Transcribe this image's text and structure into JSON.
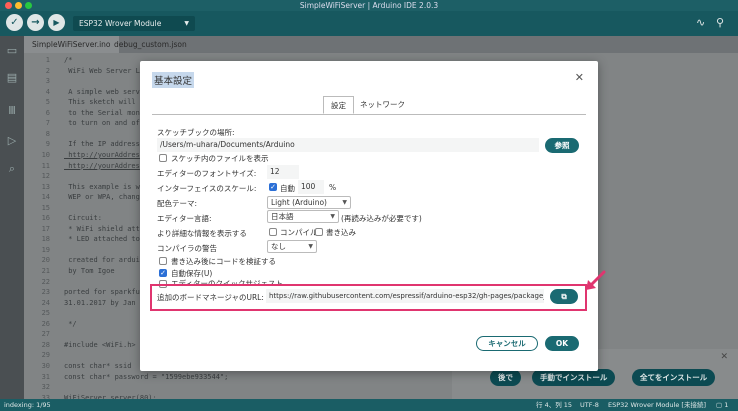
{
  "window": {
    "title": "SimpleWiFiServer | Arduino IDE 2.0.3"
  },
  "toolbar": {
    "board": "ESP32 Wrover Module"
  },
  "tabs": [
    {
      "label": "SimpleWiFiServer.ino"
    },
    {
      "label": "debug_custom.json"
    }
  ],
  "editor": {
    "lines": [
      {
        "num": "1",
        "text": "/*"
      },
      {
        "num": "2",
        "text": " WiFi Web Server L"
      },
      {
        "num": "3",
        "text": ""
      },
      {
        "num": "4",
        "text": " A simple web serv"
      },
      {
        "num": "5",
        "text": " This sketch will"
      },
      {
        "num": "6",
        "text": " to the Serial mon"
      },
      {
        "num": "7",
        "text": " to turn on and of"
      },
      {
        "num": "8",
        "text": ""
      },
      {
        "num": "9",
        "text": " If the IP address"
      },
      {
        "num": "10",
        "text": " http://yourAddres"
      },
      {
        "num": "11",
        "text": " http://yourAddres"
      },
      {
        "num": "12",
        "text": ""
      },
      {
        "num": "13",
        "text": " This example is w"
      },
      {
        "num": "14",
        "text": " WEP or WPA, chang"
      },
      {
        "num": "15",
        "text": ""
      },
      {
        "num": "16",
        "text": " Circuit:"
      },
      {
        "num": "17",
        "text": " * WiFi shield att"
      },
      {
        "num": "18",
        "text": " * LED attached to"
      },
      {
        "num": "19",
        "text": ""
      },
      {
        "num": "20",
        "text": " created for ardui"
      },
      {
        "num": "21",
        "text": " by Tom Igoe"
      },
      {
        "num": "22",
        "text": ""
      },
      {
        "num": "23",
        "text": "ported for sparkfu"
      },
      {
        "num": "24",
        "text": "31.01.2017 by Jan"
      },
      {
        "num": "25",
        "text": ""
      },
      {
        "num": "26",
        "text": " */"
      },
      {
        "num": "27",
        "text": ""
      },
      {
        "num": "28",
        "text": "#include <WiFi.h>"
      },
      {
        "num": "29",
        "text": ""
      },
      {
        "num": "30",
        "text": "const char* ssid"
      },
      {
        "num": "31",
        "text": "const char* password = \"1599ebe933544\";"
      },
      {
        "num": "32",
        "text": ""
      },
      {
        "num": "33",
        "text": "WiFiServer server(80);"
      }
    ]
  },
  "status": {
    "left": "indexing: 1/95",
    "cursor": "行 4、列 15",
    "encoding": "UTF-8",
    "board": "ESP32 Wrover Module [未接続]",
    "count": "1"
  },
  "notification": {
    "later": "後で",
    "manual": "手動でインストール",
    "install_all": "全てをインストール"
  },
  "dialog": {
    "title": "基本設定",
    "tab_settings": "設定",
    "tab_network": "ネットワーク",
    "sketchbook_label": "スケッチブックの場所:",
    "sketchbook_path": "/Users/m-uhara/Documents/Arduino",
    "browse": "参照",
    "show_files": "スケッチ内のファイルを表示",
    "font_size_label": "エディターのフォントサイズ:",
    "font_size": "12",
    "scale_label": "インターフェイスのスケール:",
    "scale_auto": "自動",
    "scale_value": "100",
    "scale_unit": "%",
    "theme_label": "配色テーマ:",
    "theme_value": "Light (Arduino)",
    "language_label": "エディター言語:",
    "language_value": "日本語",
    "language_note": "(再読み込みが必要です)",
    "verbose_label": "より詳細な情報を表示する",
    "verbose_compile": "コンパイル",
    "verbose_upload": "書き込み",
    "warnings_label": "コンパイラの警告",
    "warnings_value": "なし",
    "verify_after": "書き込み後にコードを検証する",
    "autosave": "自動保存(U)",
    "quick_suggest": "エディターのクイックサジェスト",
    "board_url_label": "追加のボードマネージャのURL:",
    "board_url_value": "https://raw.githubusercontent.com/espressif/arduino-esp32/gh-pages/package_e",
    "cancel": "キャンセル",
    "ok": "OK"
  },
  "colors": {
    "accent": "#1a6a72",
    "highlight": "#e0356f",
    "checkbox": "#2b6fd6"
  }
}
